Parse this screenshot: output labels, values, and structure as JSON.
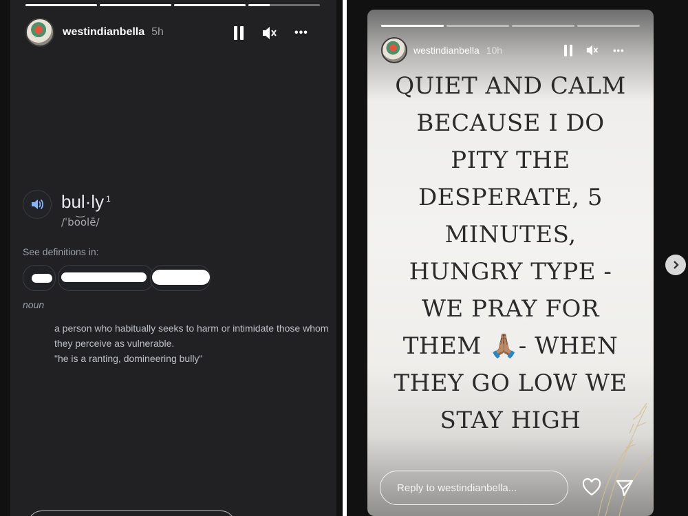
{
  "left_story": {
    "progress": [
      1,
      1,
      1,
      0.3
    ],
    "username": "westindianbella",
    "time": "5h",
    "icons": {
      "pause": "pause-icon",
      "mute": "mute-icon",
      "more": "more-icon",
      "speaker": "speaker-icon"
    },
    "more_label": "•••",
    "word": "bul·ly",
    "word_sup": "1",
    "phonetic": "/ˈbo͝olē/",
    "see_definitions": "See definitions in:",
    "part_of_speech": "noun",
    "definition": "a person who habitually seeks to harm or intimidate those whom they perceive as vulnerable.",
    "example": "\"he is a ranting, domineering bully\""
  },
  "right_story": {
    "progress": [
      1,
      0,
      0,
      0
    ],
    "username": "westindianbella",
    "time": "10h",
    "more_label": "•••",
    "quote_lines": [
      "QUIET AND CALM",
      "BECAUSE I DO",
      "PITY THE",
      "DESPERATE,  5",
      "MINUTES,",
      "HUNGRY TYPE -",
      "WE PRAY FOR",
      "THEM 🙏🏽- WHEN",
      "THEY GO LOW WE",
      "STAY HIGH"
    ],
    "reply_placeholder": "Reply to westindianbella...",
    "icons": {
      "heart": "heart-icon",
      "send": "send-icon",
      "next": "chevron-right-icon"
    }
  }
}
